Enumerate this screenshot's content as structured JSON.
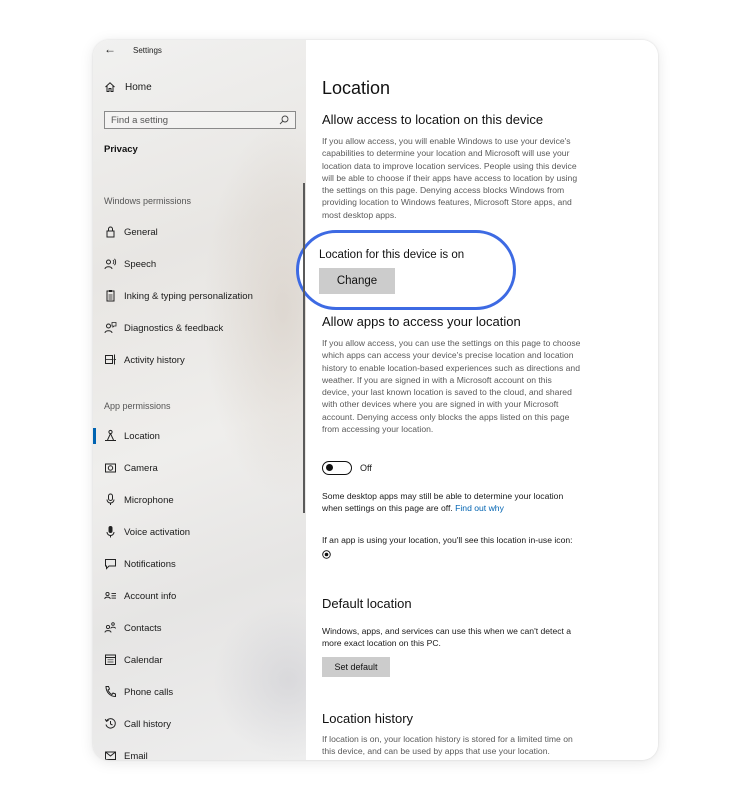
{
  "window": {
    "title": "Settings"
  },
  "sidebar": {
    "home_label": "Home",
    "search_placeholder": "Find a setting",
    "category": "Privacy",
    "sections": [
      {
        "label": "Windows permissions",
        "items": [
          {
            "label": "General",
            "icon": "lock-icon"
          },
          {
            "label": "Speech",
            "icon": "speech-icon"
          },
          {
            "label": "Inking & typing personalization",
            "icon": "clipboard-icon"
          },
          {
            "label": "Diagnostics & feedback",
            "icon": "feedback-icon"
          },
          {
            "label": "Activity history",
            "icon": "activity-icon"
          }
        ]
      },
      {
        "label": "App permissions",
        "items": [
          {
            "label": "Location",
            "icon": "location-icon",
            "active": true
          },
          {
            "label": "Camera",
            "icon": "camera-icon"
          },
          {
            "label": "Microphone",
            "icon": "microphone-icon"
          },
          {
            "label": "Voice activation",
            "icon": "voice-icon"
          },
          {
            "label": "Notifications",
            "icon": "notification-icon"
          },
          {
            "label": "Account info",
            "icon": "account-icon"
          },
          {
            "label": "Contacts",
            "icon": "contacts-icon"
          },
          {
            "label": "Calendar",
            "icon": "calendar-icon"
          },
          {
            "label": "Phone calls",
            "icon": "phone-icon"
          },
          {
            "label": "Call history",
            "icon": "history-icon"
          },
          {
            "label": "Email",
            "icon": "email-icon"
          }
        ]
      }
    ]
  },
  "main": {
    "title": "Location",
    "allow_access": {
      "heading": "Allow access to location on this device",
      "lines": [
        "If you allow access, you will enable Windows to use your device's",
        "capabilities to determine your location and Microsoft will use your",
        "location data to improve location services. People using this device",
        "will be able to choose if their apps have access to location by using",
        "the settings on this page. Denying access blocks Windows from",
        "providing location to Windows features, Microsoft Store apps, and",
        "most desktop apps."
      ],
      "status": "Location for this device is on",
      "change_label": "Change"
    },
    "allow_apps": {
      "heading": "Allow apps to access your location",
      "lines": [
        "If you allow access, you can use the settings on this page to choose",
        "which apps can access your device's precise location and location",
        "history to enable location-based experiences such as directions and",
        "weather. If you are signed in with a Microsoft account on this",
        "device, your last known location is saved to the cloud, and shared",
        "with other devices where you are signed in with your Microsoft",
        "account. Denying access only blocks the apps listed on this page",
        "from accessing your location."
      ],
      "toggle_state": "Off",
      "desktop_note_lines": [
        "Some desktop apps may still be able to determine your location",
        "when settings on this page are off."
      ],
      "find_out_why": "Find out why",
      "inuse_note": "If an app is using your location, you'll see this location in-use icon:"
    },
    "default_location": {
      "heading": "Default location",
      "lines": [
        "Windows, apps, and services can use this when we can't detect a",
        "more exact location on this PC."
      ],
      "button": "Set default"
    },
    "location_history": {
      "heading": "Location history",
      "lines": [
        "If location is on, your location history is stored for a limited time on",
        "this device, and can be used by apps that use your location."
      ]
    }
  },
  "colors": {
    "accent": "#0063b1",
    "highlight_ring": "#3d6ae3",
    "button_bg": "#cccccc"
  }
}
